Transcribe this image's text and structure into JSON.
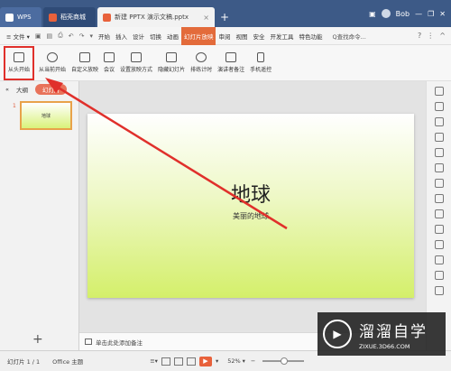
{
  "titlebar": {
    "tabs": [
      {
        "label": "WPS"
      },
      {
        "label": "稻壳商城"
      },
      {
        "label": "新建 PPTX 演示文稿.pptx"
      }
    ],
    "add_tab": "+",
    "user": "Bob"
  },
  "menu": {
    "file": "≡ 文件 ▾",
    "items": [
      "开始",
      "插入",
      "设计",
      "切换",
      "动画",
      "幻灯片放映",
      "审阅",
      "视图",
      "安全",
      "开发工具",
      "特色功能"
    ],
    "active": "幻灯片放映",
    "search": "Q查找命令...",
    "help": "?",
    "more": "⋮",
    "collapse": "^"
  },
  "ribbon": {
    "buttons": [
      {
        "label": "从头开始",
        "highlight": true
      },
      {
        "label": "从当前开始"
      },
      {
        "label": "自定义放映"
      },
      {
        "label": "会议"
      },
      {
        "label": "设置放映方式"
      },
      {
        "label": "隐藏幻灯片"
      },
      {
        "label": "排练计时"
      },
      {
        "label": "演讲者备注"
      },
      {
        "label": "手机遥控"
      }
    ]
  },
  "leftpanel": {
    "tab_outline": "大纲",
    "tab_slides": "幻灯片",
    "thumb_number": "1",
    "thumb_title": "地球",
    "add": "+"
  },
  "slide": {
    "title": "地球",
    "subtitle": "美丽的地球"
  },
  "notes": {
    "placeholder": "单击此处添加备注"
  },
  "status": {
    "slide_index": "幻灯片 1 / 1",
    "theme": "Office 主题",
    "zoom": "52%"
  },
  "watermark": {
    "brand": "溜溜自学",
    "url": "ZIXUE.3D66.COM"
  },
  "colors": {
    "accent": "#e36b3b",
    "highlight_box": "#e0302b"
  }
}
